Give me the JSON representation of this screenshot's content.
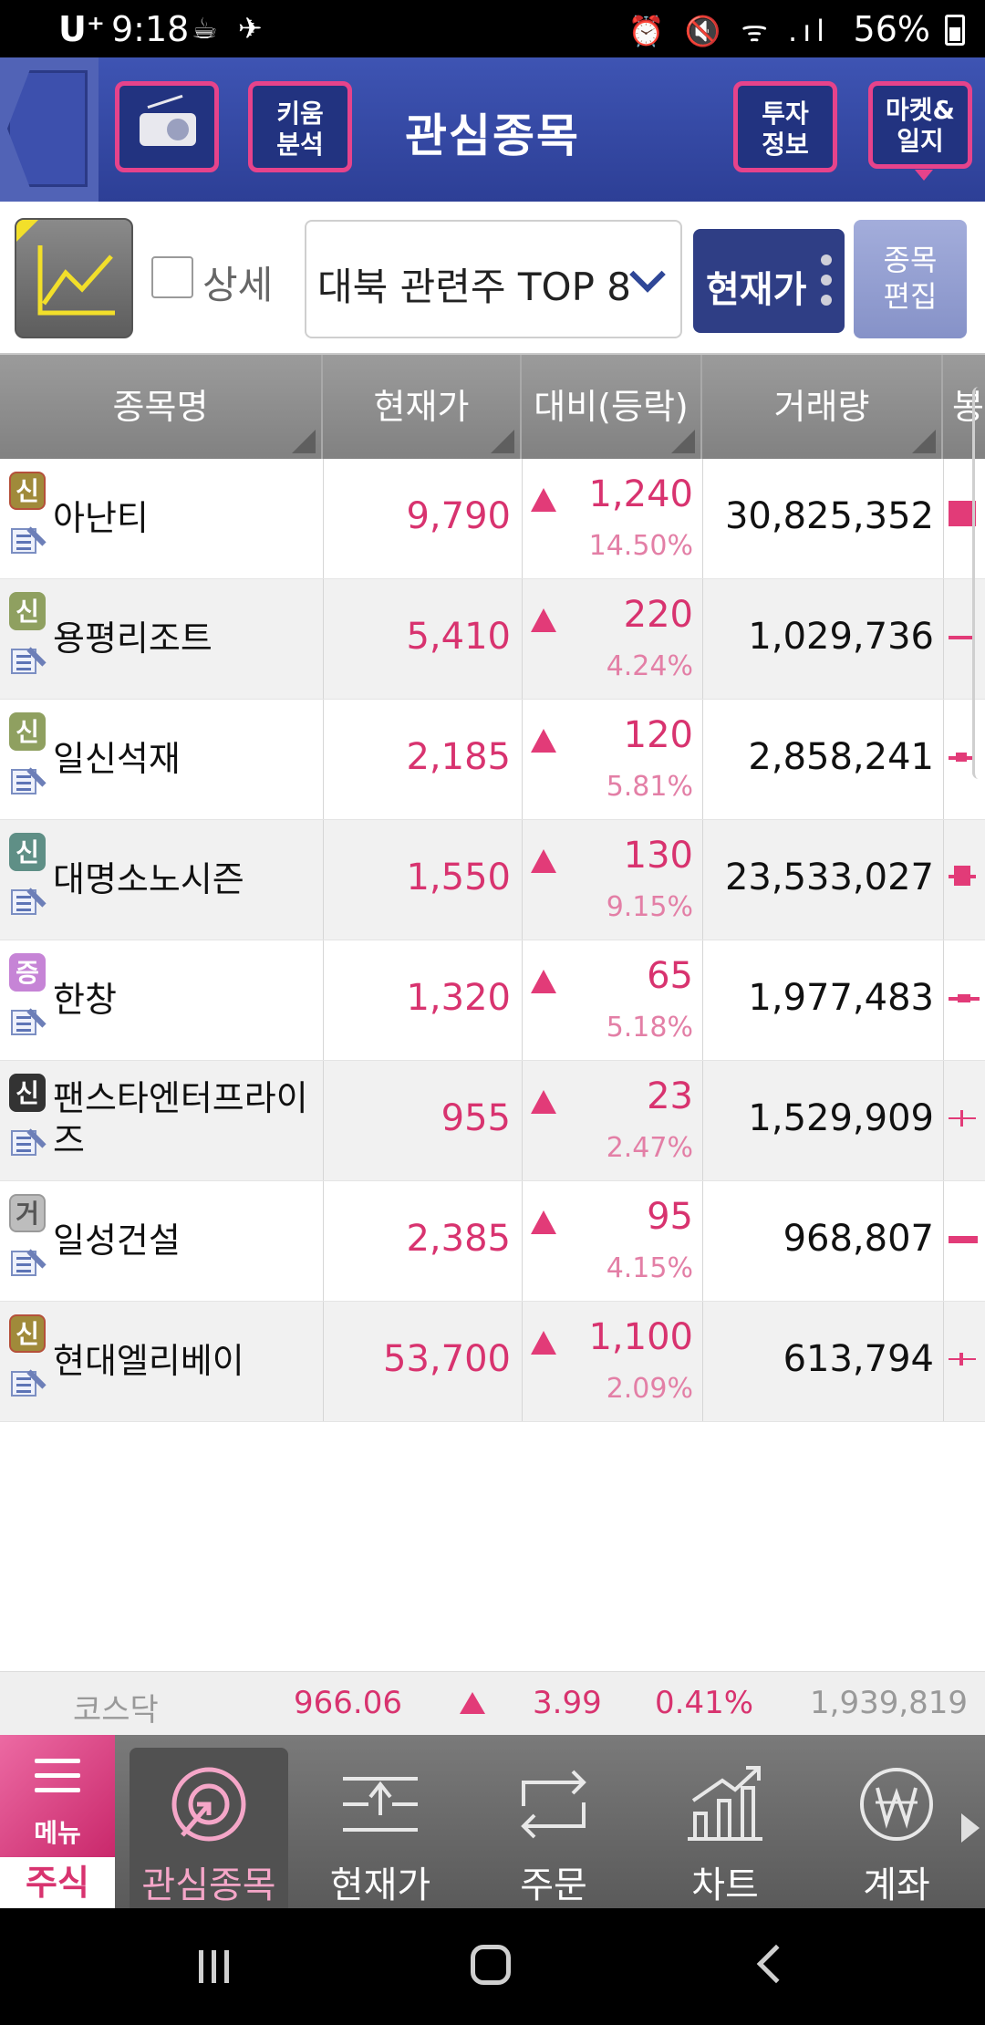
{
  "status_bar": {
    "carrier": "U⁺",
    "time": "9:18",
    "left_icons": "☕ ✈",
    "right_icons": "⏰ 🔇 ᯤ .ıl",
    "battery": "56%"
  },
  "header": {
    "title": "관심종목",
    "kiwoom_analysis": "키움\n분석",
    "invest_info": "투자\n정보",
    "market_journal": "마켓&\n일지"
  },
  "toolbar": {
    "detail_label": "상세",
    "group_select": "대북 관련주 TOP 8",
    "price_button": "현재가",
    "edit_button": "종목\n편집"
  },
  "table": {
    "columns": [
      "종목명",
      "현재가",
      "대비(등락)",
      "거래량",
      "봉"
    ],
    "rows": [
      {
        "badge": "신",
        "badge_color": "#a08a3a",
        "name": "아난티",
        "price": "9,790",
        "diff": "1,240",
        "pct": "14.50%",
        "volume": "30,825,352"
      },
      {
        "badge": "신",
        "badge_color": "#8fa060",
        "name": "용평리조트",
        "price": "5,410",
        "diff": "220",
        "pct": "4.24%",
        "volume": "1,029,736"
      },
      {
        "badge": "신",
        "badge_color": "#8fa060",
        "name": "일신석재",
        "price": "2,185",
        "diff": "120",
        "pct": "5.81%",
        "volume": "2,858,241"
      },
      {
        "badge": "신",
        "badge_color": "#5f8f86",
        "name": "대명소노시즌",
        "price": "1,550",
        "diff": "130",
        "pct": "9.15%",
        "volume": "23,533,027"
      },
      {
        "badge": "증",
        "badge_color": "#c684d6",
        "name": "한창",
        "price": "1,320",
        "diff": "65",
        "pct": "5.18%",
        "volume": "1,977,483"
      },
      {
        "badge": "신",
        "badge_color": "#333333",
        "name": "팬스타엔터프라이즈",
        "price": "955",
        "diff": "23",
        "pct": "2.47%",
        "volume": "1,529,909"
      },
      {
        "badge": "거",
        "badge_color": "#bdbdbd",
        "name": "일성건설",
        "price": "2,385",
        "diff": "95",
        "pct": "4.15%",
        "volume": "968,807"
      },
      {
        "badge": "신",
        "badge_color": "#a08a3a",
        "name": "현대엘리베이",
        "price": "53,700",
        "diff": "1,100",
        "pct": "2.09%",
        "volume": "613,794"
      }
    ]
  },
  "index_bar": {
    "name": "코스닥",
    "value": "966.06",
    "change": "3.99",
    "pct": "0.41%",
    "volume": "1,939,819"
  },
  "bottom_nav": {
    "menu": "메뉴",
    "stock": "주식",
    "items": [
      "관심종목",
      "현재가",
      "주문",
      "차트",
      "계좌"
    ]
  }
}
